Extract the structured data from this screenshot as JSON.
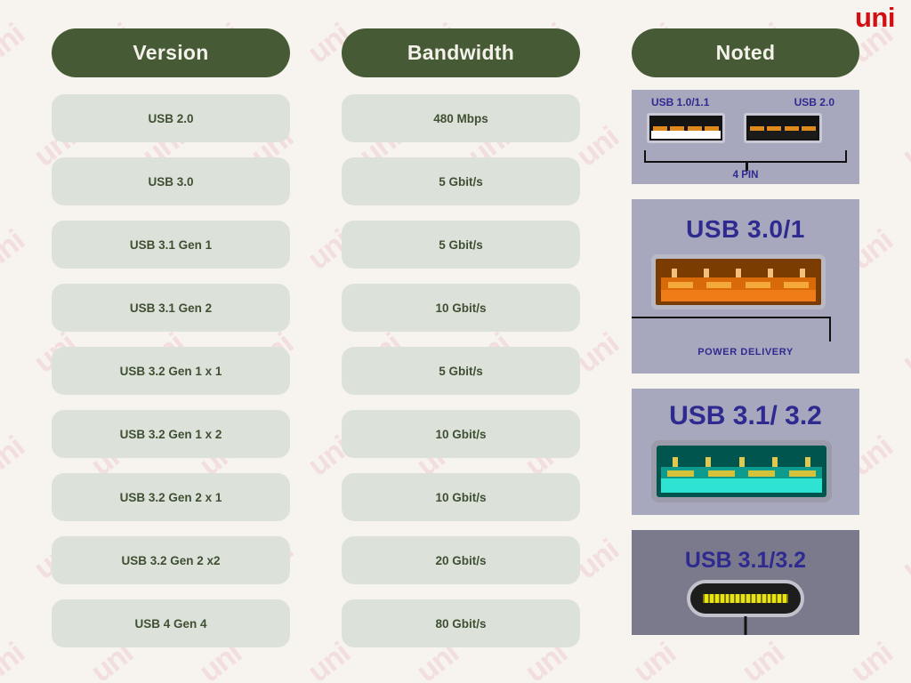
{
  "brand": {
    "logo_text": "uni"
  },
  "table": {
    "headers": [
      "Version",
      "Bandwidth",
      "Noted"
    ],
    "rows": [
      {
        "version": "USB 2.0",
        "bandwidth": "480 Mbps"
      },
      {
        "version": "USB 3.0",
        "bandwidth": "5 Gbit/s"
      },
      {
        "version": "USB 3.1 Gen 1",
        "bandwidth": "5 Gbit/s"
      },
      {
        "version": "USB 3.1 Gen 2",
        "bandwidth": "10 Gbit/s"
      },
      {
        "version": "USB 3.2 Gen 1 x 1",
        "bandwidth": "5 Gbit/s"
      },
      {
        "version": "USB 3.2 Gen 1 x 2",
        "bandwidth": "10 Gbit/s"
      },
      {
        "version": "USB 3.2 Gen 2 x 1",
        "bandwidth": "10 Gbit/s"
      },
      {
        "version": "USB 3.2 Gen 2 x2",
        "bandwidth": "20 Gbit/s"
      },
      {
        "version": "USB 4 Gen 4",
        "bandwidth": "80 Gbit/s"
      }
    ]
  },
  "noted_images": [
    {
      "id": "usb-a-1-2",
      "label_left": "USB 1.0/1.1",
      "label_right": "USB 2.0",
      "caption": "4 PIN"
    },
    {
      "id": "usb-a-3",
      "title": "USB 3.0/1",
      "caption": "POWER DELIVERY"
    },
    {
      "id": "usb-a-31-32",
      "title": "USB 3.1/ 3.2"
    },
    {
      "id": "usb-c-31-32",
      "title": "USB 3.1/3.2"
    }
  ],
  "watermark": {
    "text": "uni"
  },
  "colors": {
    "page_background": "#f7f3ee",
    "header_green": "#455A35",
    "cell_sage": "#dce2da",
    "cell_text": "#3f4f32",
    "logo_red": "#d40f14",
    "watermark_pink": "#f2dede",
    "port_panel": "#a7a8bd",
    "port_panel_dark": "#7b7a8c",
    "port_label_blue": "#2e2a8f"
  }
}
